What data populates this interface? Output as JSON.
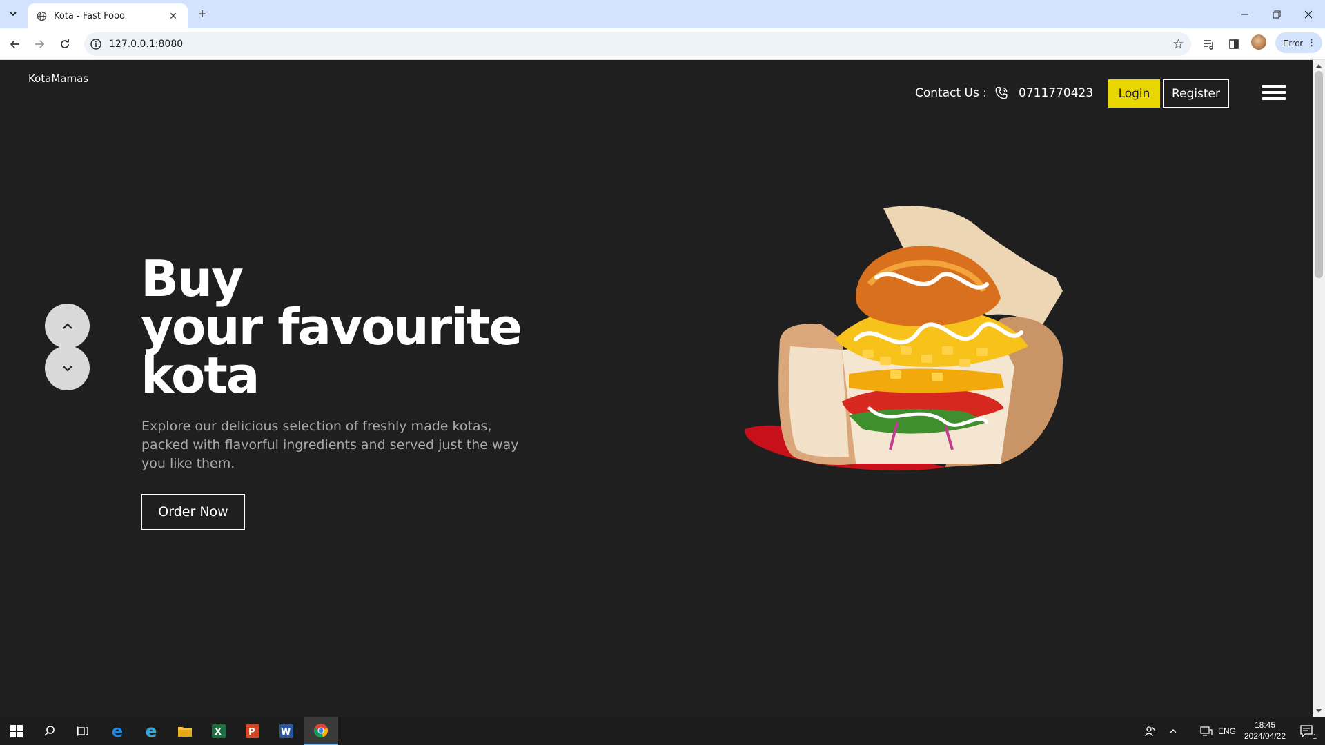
{
  "browser": {
    "tab_title": "Kota - Fast Food",
    "url": "127.0.0.1:8080",
    "profile_status": "Error"
  },
  "site": {
    "brand": "KotaMamas",
    "contact_label": "Contact Us :",
    "phone": "0711770423",
    "login_label": "Login",
    "register_label": "Register",
    "hero": {
      "title_line1": "Buy",
      "title_line2": "your favourite",
      "title_line3": "kota",
      "description": "Explore our delicious selection of freshly made kotas, packed with flavorful ingredients and served just the way you like them.",
      "cta_label": "Order Now"
    },
    "colors": {
      "background": "#1f1f1f",
      "accent": "#e8d600",
      "text": "#ffffff",
      "muted_text": "#a9a9a9"
    }
  },
  "taskbar": {
    "language": "ENG",
    "time": "18:45",
    "date": "2024/04/22",
    "notification_count": "1"
  }
}
